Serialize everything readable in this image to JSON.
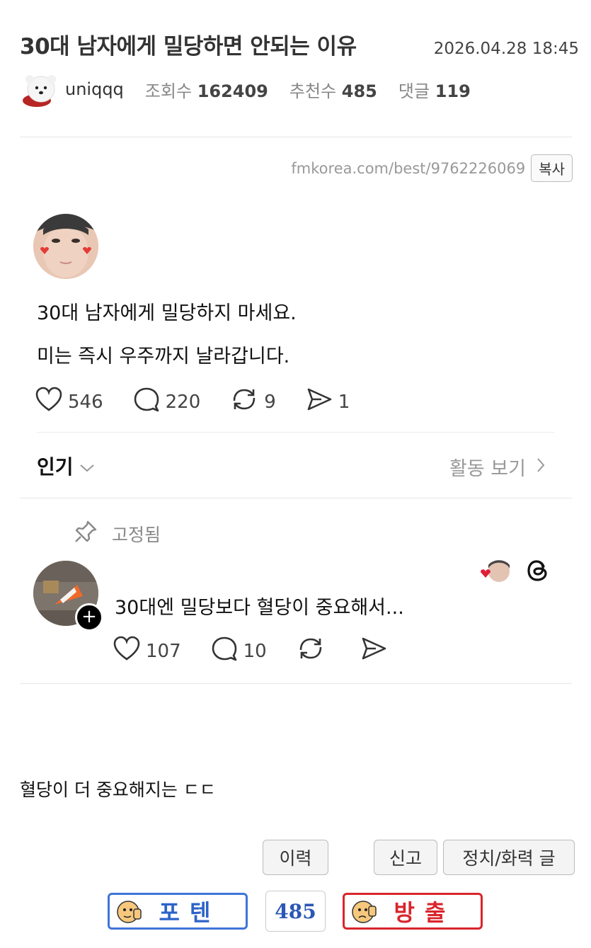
{
  "post": {
    "title": "30대 남자에게 밀당하면 안되는 이유",
    "date": "2026.04.28 18:45",
    "author": "uniqqq",
    "views_label": "조회수",
    "views": "162409",
    "recommend_label": "추천수",
    "recommend": "485",
    "comments_label": "댓글",
    "comments": "119",
    "url": "fmkorea.com/best/9762226069",
    "copy_label": "복사",
    "body": "혈당이 더 중요해지는 ㄷㄷ"
  },
  "embed": {
    "line1": "30대 남자에게 밀당하지 마세요.",
    "line2": "미는 즉시 우주까지 날라갑니다.",
    "likes": "546",
    "replies": "220",
    "reposts": "9",
    "shares": "1",
    "sort_label": "인기",
    "activity_label": "활동 보기",
    "pinned_label": "고정됨",
    "comment": {
      "text": "30대엔 밀당보다 혈당이 중요해서...",
      "likes": "107",
      "replies": "10"
    }
  },
  "buttons": {
    "history": "이력",
    "report": "신고",
    "politics": "정치/화력 글",
    "poten": "포텐",
    "vote_count": "485",
    "release": "방출"
  },
  "colors": {
    "poten_border": "#3f74d8",
    "poten_text": "#2d63c8",
    "release_border": "#d9252c",
    "release_text": "#d9252c",
    "count_text": "#2a57b5"
  },
  "icons": [
    "heart-icon",
    "comment-bubble-icon",
    "repost-icon",
    "send-icon",
    "pin-icon",
    "threads-icon",
    "chevron-down-icon",
    "chevron-right-icon",
    "plus-icon"
  ]
}
